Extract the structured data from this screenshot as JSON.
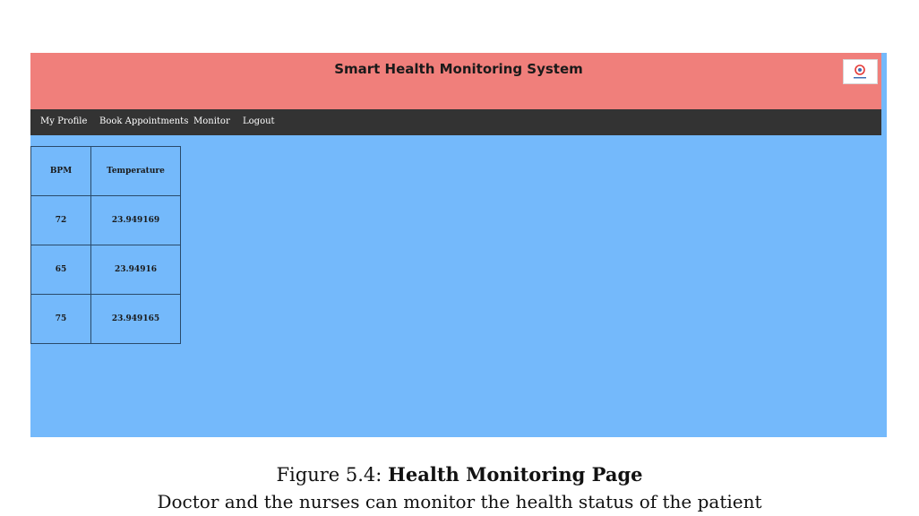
{
  "app": {
    "title": "Smart Health Monitoring System"
  },
  "nav": {
    "items": [
      {
        "label": "My Profile"
      },
      {
        "label": "Book Appointments"
      },
      {
        "label": "Monitor"
      },
      {
        "label": "Logout"
      }
    ]
  },
  "table": {
    "headers": [
      "BPM",
      "Temperature"
    ],
    "rows": [
      [
        "72",
        "23.949169"
      ],
      [
        "65",
        "23.94916"
      ],
      [
        "75",
        "23.949165"
      ]
    ]
  },
  "caption": {
    "figure_label": "Figure 5.4:",
    "figure_title": "Health Monitoring Page",
    "description": "Doctor and the nurses can monitor the health status of the patient"
  },
  "colors": {
    "header_bg": "#f07f7b",
    "navbar_bg": "#333333",
    "page_bg": "#74b9fb",
    "logo_accent": "#e53935"
  }
}
